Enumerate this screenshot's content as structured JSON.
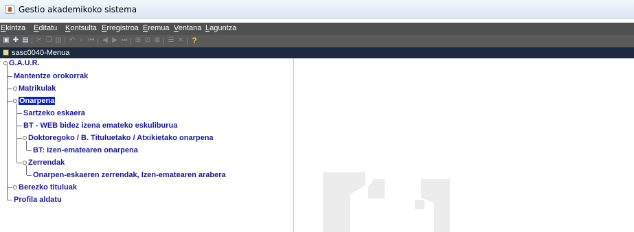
{
  "window": {
    "title": "Gestio akademikoko sistema",
    "icon": "java-icon"
  },
  "menubar": [
    {
      "mnemonic": "E",
      "rest": "kintza"
    },
    {
      "mnemonic": "E",
      "rest": "ditatu"
    },
    {
      "mnemonic": "K",
      "rest": "ontsulta"
    },
    {
      "mnemonic": "E",
      "rest": "rregistroa"
    },
    {
      "mnemonic": "E",
      "rest": "remua"
    },
    {
      "mnemonic": "V",
      "rest": "entana"
    },
    {
      "mnemonic": "L",
      "rest": "aguntza"
    }
  ],
  "toolbar": {
    "icons": [
      "save-icon",
      "insert-record-icon",
      "print-icon",
      "cut-icon",
      "copy-icon",
      "paste-icon",
      "undo-icon",
      "find-icon",
      "first-record-icon",
      "previous-record-icon",
      "next-record-icon",
      "last-record-icon",
      "enter-query-icon",
      "execute-query-icon",
      "cancel-query-icon",
      "list-icon",
      "close-icon",
      "help-icon"
    ],
    "help_glyph": "?"
  },
  "inner_window": {
    "title": "sasc0040-Menua"
  },
  "tree": {
    "root": "G.A.U.R.",
    "items": [
      "Mantentze orokorrak",
      "Matrikulak",
      "Onarpena",
      "Sartzeko eskaera",
      "BT - WEB bidez izena emateko eskuliburua",
      "Doktoregoko / B. Tituluetako / Atxikietako onarpena",
      "BT: Izen-ematearen onarpena",
      "Zerrendak",
      "Onarpen-eskaeren zerrendak, Izen-ematearen arabera",
      "Berezko tituluak",
      "Profila aldatu"
    ],
    "selected": "Onarpena"
  },
  "colors": {
    "tree_text": "#16189a",
    "selection": "#0a22c8",
    "menubar_bg": "#505050",
    "inner_title_bg": "#1c2a40"
  }
}
